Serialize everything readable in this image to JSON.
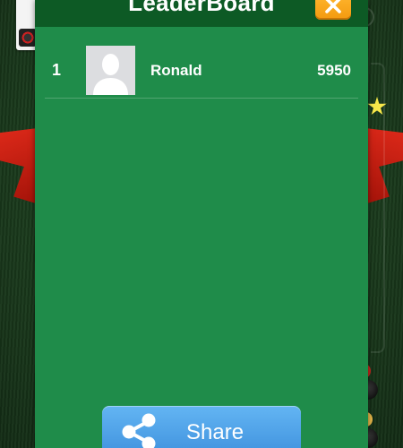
{
  "modal": {
    "title": "LeaderBoard",
    "close_icon": "close-icon",
    "share_label": "Share",
    "share_icon": "share-icon"
  },
  "leaderboard": {
    "rows": [
      {
        "rank": "1",
        "name": "Ronald",
        "score": "5950",
        "avatar": "default-avatar-icon"
      }
    ]
  },
  "colors": {
    "panel": "#1f8c4a",
    "header": "#0d5a25",
    "close_button": "#f7a51c",
    "share_button": "#4a9ee6",
    "table_felt": "#1d3f1f"
  }
}
